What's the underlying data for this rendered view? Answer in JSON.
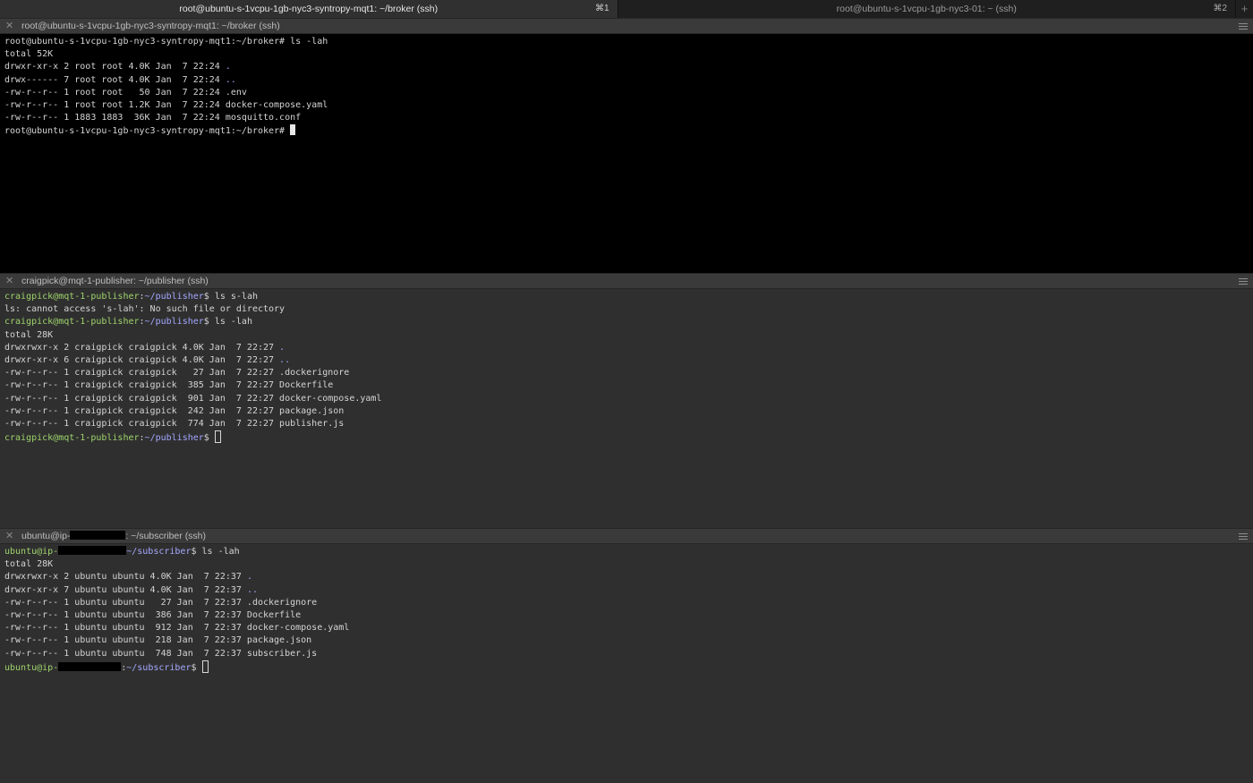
{
  "tabs": [
    {
      "title": "root@ubuntu-s-1vcpu-1gb-nyc3-syntropy-mqt1: ~/broker (ssh)",
      "shortcut": "⌘1",
      "active": true
    },
    {
      "title": "root@ubuntu-s-1vcpu-1gb-nyc3-01: ~ (ssh)",
      "shortcut": "⌘2",
      "active": false
    }
  ],
  "new_tab_label": "+",
  "panes": {
    "broker": {
      "title": "root@ubuntu-s-1vcpu-1gb-nyc3-syntropy-mqt1: ~/broker (ssh)",
      "prompt": "root@ubuntu-s-1vcpu-1gb-nyc3-syntropy-mqt1:~/broker# ",
      "command": "ls -lah",
      "lines": [
        "total 52K",
        "drwxr-xr-x 2 root root 4.0K Jan  7 22:24 ",
        "drwx------ 7 root root 4.0K Jan  7 22:24 ",
        "-rw-r--r-- 1 root root   50 Jan  7 22:24 .env",
        "-rw-r--r-- 1 root root 1.2K Jan  7 22:24 docker-compose.yaml",
        "-rw-r--r-- 1 1883 1883  36K Jan  7 22:24 mosquitto.conf"
      ],
      "dirs": [
        ".",
        ".."
      ]
    },
    "publisher": {
      "title": "craigpick@mqt-1-publisher: ~/publisher (ssh)",
      "prompt_user": "craigpick@mqt-1-publisher",
      "prompt_sep": ":",
      "prompt_path": "~/publisher",
      "prompt_end": "$ ",
      "cmd1": "ls s-lah",
      "error": "ls: cannot access 's-lah': No such file or directory",
      "cmd2": "ls -lah",
      "lines": [
        "total 28K",
        "drwxrwxr-x 2 craigpick craigpick 4.0K Jan  7 22:27 ",
        "drwxr-xr-x 6 craigpick craigpick 4.0K Jan  7 22:27 ",
        "-rw-r--r-- 1 craigpick craigpick   27 Jan  7 22:27 .dockerignore",
        "-rw-r--r-- 1 craigpick craigpick  385 Jan  7 22:27 Dockerfile",
        "-rw-r--r-- 1 craigpick craigpick  901 Jan  7 22:27 docker-compose.yaml",
        "-rw-r--r-- 1 craigpick craigpick  242 Jan  7 22:27 package.json",
        "-rw-r--r-- 1 craigpick craigpick  774 Jan  7 22:27 publisher.js"
      ],
      "dirs": [
        ".",
        ".."
      ]
    },
    "subscriber": {
      "title_pre": "ubuntu@ip-",
      "title_post": ": ~/subscriber (ssh)",
      "prompt_user": "ubuntu@ip-",
      "prompt_path": "~/subscriber",
      "prompt_sep": ":",
      "prompt_end": "$ ",
      "command": "ls -lah",
      "lines": [
        "total 28K",
        "drwxrwxr-x 2 ubuntu ubuntu 4.0K Jan  7 22:37 ",
        "drwxr-xr-x 7 ubuntu ubuntu 4.0K Jan  7 22:37 ",
        "-rw-r--r-- 1 ubuntu ubuntu   27 Jan  7 22:37 .dockerignore",
        "-rw-r--r-- 1 ubuntu ubuntu  386 Jan  7 22:37 Dockerfile",
        "-rw-r--r-- 1 ubuntu ubuntu  912 Jan  7 22:37 docker-compose.yaml",
        "-rw-r--r-- 1 ubuntu ubuntu  218 Jan  7 22:37 package.json",
        "-rw-r--r-- 1 ubuntu ubuntu  748 Jan  7 22:37 subscriber.js"
      ],
      "dirs": [
        ".",
        ".."
      ]
    }
  },
  "colors": {
    "prompt_user": "#9ed36b",
    "prompt_path": "#a3a8ff",
    "broker_bg": "#000000",
    "pane_bg": "#2f2f2f"
  },
  "icons": {
    "pane_close": "close-icon",
    "pane_menu": "hamburger-menu-icon"
  }
}
